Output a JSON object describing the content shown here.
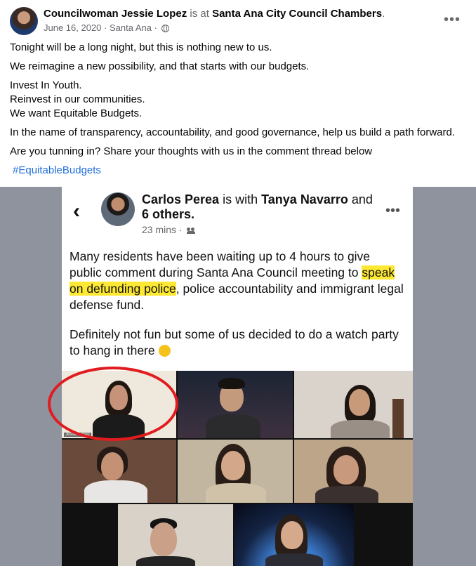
{
  "post": {
    "author": "Councilwoman Jessie Lopez",
    "is_at": "is at",
    "location": "Santa Ana City Council Chambers",
    "date": "June 16, 2020",
    "sep": "·",
    "city": "Santa Ana",
    "more_icon": "more-horizontal-icon",
    "privacy_icon": "globe-icon",
    "lines": [
      "Tonight will be a long night, but this is nothing new to us.",
      "We reimagine a new possibility, and that starts with our budgets.",
      "Invest In Youth.",
      "Reinvest in our communities.",
      "We want Equitable Budgets.",
      "In the name of transparency, accountability, and good governance, help us build a path forward.",
      "Are you tunning in? Share your thoughts with us in the comment thread below"
    ],
    "hashtag": "#EquitableBudgets"
  },
  "shared": {
    "author": "Carlos Perea",
    "is_with": "is with",
    "tagged": "Tanya Navarro",
    "and": "and",
    "others": "6 others.",
    "time": "23 mins",
    "sep": "·",
    "text_part1": "Many residents have been waiting up to 4 hours to give public comment during Santa Ana Council meeting to",
    "highlight": "speak on defunding police",
    "text_part2": ", police accountability and immigrant legal defense fund.",
    "text_p2": "Definitely not fun but some of us decided to do a watch party to hang in there",
    "emoji": "grinning-sweat-emoji",
    "tile_label": "Jessie Lopez"
  },
  "colors": {
    "highlight": "#fde833",
    "circle": "#e11b1f",
    "link": "#216fdb"
  }
}
